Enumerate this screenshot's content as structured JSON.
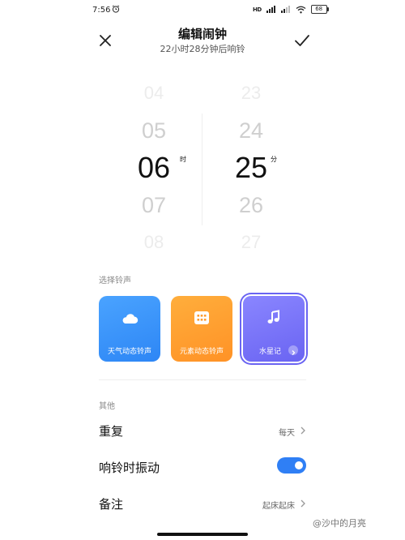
{
  "status_bar": {
    "time": "7:56",
    "signal_text": "HD",
    "battery": "68"
  },
  "header": {
    "title": "编辑闹钟",
    "subtitle": "22小时28分钟后响铃"
  },
  "time_picker": {
    "hour": {
      "values": [
        "04",
        "05",
        "06",
        "07",
        "08"
      ],
      "unit": "时"
    },
    "minute": {
      "values": [
        "23",
        "24",
        "25",
        "26",
        "27"
      ],
      "unit": "分"
    }
  },
  "sound": {
    "section_label": "选择铃声",
    "cards": [
      {
        "label": "天气动态铃声"
      },
      {
        "label": "元素动态铃声"
      },
      {
        "label": "水星记"
      }
    ]
  },
  "other": {
    "section_label": "其他",
    "repeat": {
      "label": "重复",
      "value": "每天"
    },
    "vibrate": {
      "label": "响铃时振动",
      "enabled": true
    },
    "note": {
      "label": "备注",
      "value": "起床起床"
    }
  },
  "watermark": "@沙中的月亮",
  "colors": {
    "accent": "#2f7ff5",
    "weather_card": "#2d86f5",
    "element_card": "#ff9226",
    "music_card": "#6a64f2"
  }
}
